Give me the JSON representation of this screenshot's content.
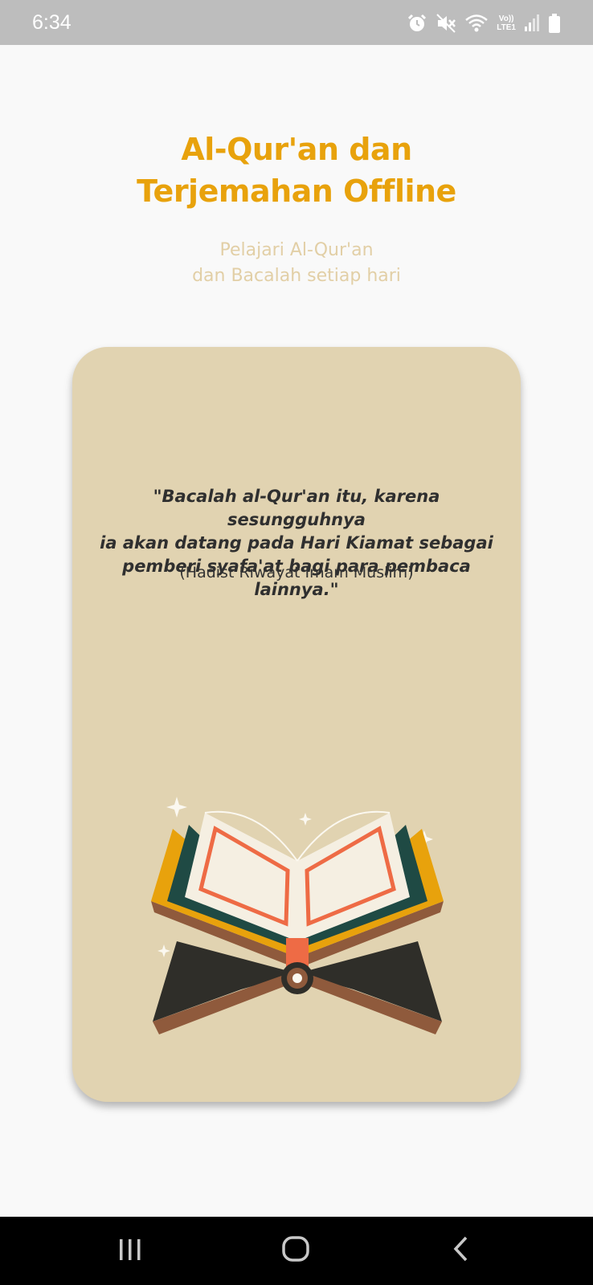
{
  "status_bar": {
    "time": "6:34",
    "icons": [
      "alarm-icon",
      "mute-icon",
      "wifi-icon",
      "volte-lte-icon",
      "signal-icon",
      "battery-icon"
    ],
    "lte_label_top": "Vo))",
    "lte_label_bottom": "LTE1"
  },
  "header": {
    "title_line1": "Al-Qur'an dan",
    "title_line2": "Terjemahan Offline",
    "subtitle_line1": "Pelajari Al-Qur'an",
    "subtitle_line2": "dan Bacalah setiap hari"
  },
  "card": {
    "quote_line1": "\"Bacalah al-Qur'an itu, karena sesungguhnya",
    "quote_line2": "ia akan datang pada Hari Kiamat sebagai",
    "quote_line3": "pemberi syafa'at bagi para pembaca lainnya.\"",
    "source": "(Hadist Riwayat Imam Muslim)",
    "illustration": "quran-on-stand-illustration"
  },
  "nav_bar": {
    "buttons": [
      "recent-apps-icon",
      "home-icon",
      "back-icon"
    ]
  },
  "colors": {
    "accent": "#e8a20c",
    "subtitle": "#e2cfa6",
    "card_bg": "#e1d3b1",
    "status_bar": "#bdbdbd"
  }
}
